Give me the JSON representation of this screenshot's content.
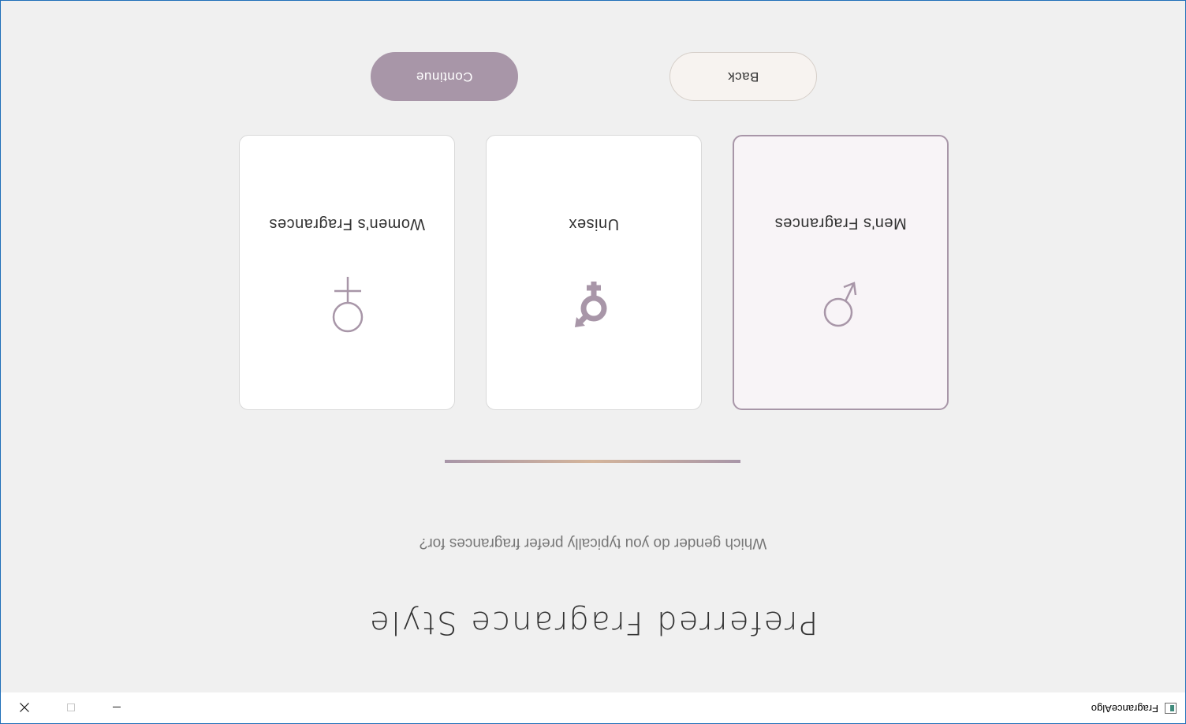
{
  "window": {
    "title": "FragranceAlgo",
    "minimize_glyph": "—",
    "maximize_glyph": "☐",
    "close_glyph": "✕"
  },
  "orientation": "rotated-180-degrees",
  "page": {
    "title": "Preferred Fragrance Style",
    "subtitle": "Which gender do you typically prefer fragrances for?"
  },
  "options": [
    {
      "label": "Men's Fragrances",
      "icon": "male-symbol-icon",
      "selected": true
    },
    {
      "label": "Unisex",
      "icon": "transgender-symbol-icon",
      "selected": false
    },
    {
      "label": "Women's Fragrances",
      "icon": "female-symbol-icon",
      "selected": false
    }
  ],
  "buttons": {
    "back": "Back",
    "continue": "Continue"
  },
  "colors": {
    "accent": "#a896a8",
    "background": "#f0f0f0",
    "card": "#ffffff",
    "selected_card": "#f8f4f7",
    "back_button": "#f7f3f0",
    "divider_middle": "#d4b59b"
  }
}
